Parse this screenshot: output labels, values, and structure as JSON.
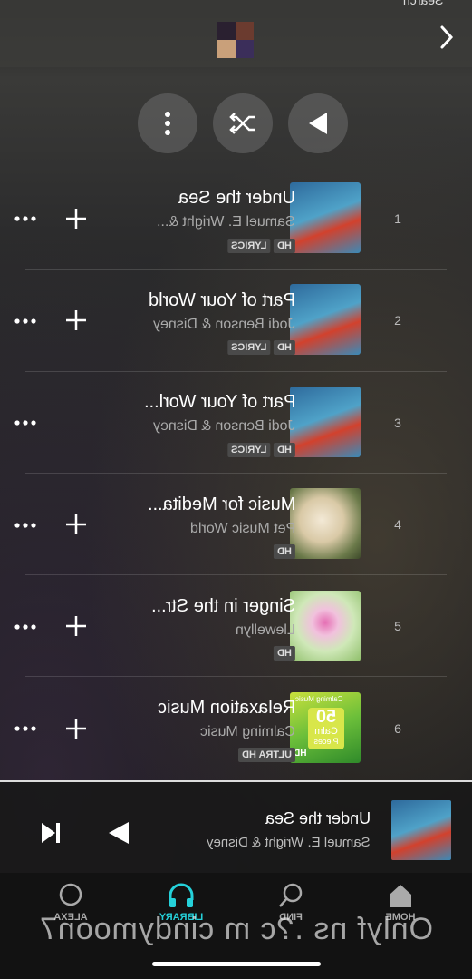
{
  "header": {
    "search_label": "Search",
    "next_icon": "chevron-right-icon"
  },
  "controls": {
    "more_icon": "vertical-dots-icon",
    "shuffle_icon": "shuffle-icon",
    "play_icon": "play-icon"
  },
  "tracks": [
    {
      "num": "1",
      "title": "Under the Sea",
      "artist": "Samuel E. Wright &...",
      "badges": [
        "HD",
        "LYRICS"
      ]
    },
    {
      "num": "2",
      "title": "Part of Your World",
      "artist": "Jodi Benson & Disney",
      "badges": [
        "HD",
        "LYRICS"
      ]
    },
    {
      "num": "3",
      "title": "Part of Your Worl...",
      "artist": "Jodi Benson & Disney",
      "badges": [
        "HD",
        "LYRICS"
      ]
    },
    {
      "num": "4",
      "title": "Music for Medita...",
      "artist": "Pet Music World",
      "badges": [
        "HD"
      ]
    },
    {
      "num": "5",
      "title": "Singer in the Str...",
      "artist": "Llewellyn",
      "badges": [
        "HD"
      ]
    },
    {
      "num": "6",
      "title": "Relaxation Music",
      "artist": "Calming Music",
      "badges": [
        "ULTRA HD"
      ]
    }
  ],
  "album_art_text": {
    "calm_50": "50",
    "calm_word": "Calm",
    "calm_pieces": "Pieces",
    "calm_top": "Calming Music",
    "calm_hd": "HD"
  },
  "now_playing": {
    "title": "Under the Sea",
    "artist": "Samuel E. Wright & Disney"
  },
  "nav": {
    "home": "HOME",
    "find": "FIND",
    "library": "LIBRARY",
    "alexa": "ALEXA"
  },
  "colors": {
    "accent": "#25d1da"
  },
  "watermark": "Onlyf ns .?c m cindymoon7"
}
